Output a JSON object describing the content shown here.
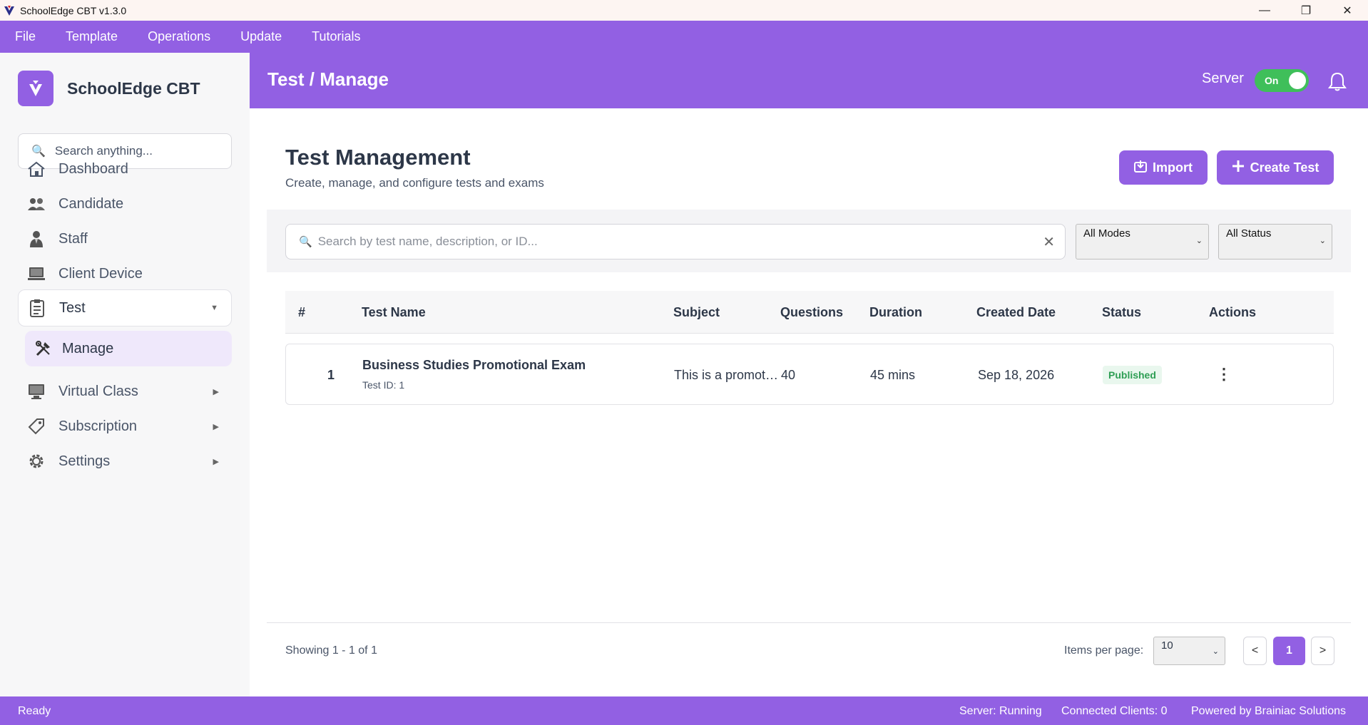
{
  "window": {
    "title": "SchoolEdge CBT v1.3.0",
    "controls": [
      "—",
      "❐",
      "✕"
    ]
  },
  "menubar": {
    "items": [
      "File",
      "Template",
      "Operations",
      "Update",
      "Tutorials"
    ]
  },
  "sidebar": {
    "brand": "SchoolEdge CBT",
    "search_placeholder": "Search anything...",
    "items": [
      {
        "label": "Dashboard",
        "icon": "house-icon"
      },
      {
        "label": "Candidate",
        "icon": "users-icon"
      },
      {
        "label": "Staff",
        "icon": "staff-icon"
      },
      {
        "label": "Client Device",
        "icon": "laptop-icon"
      },
      {
        "label": "Test",
        "icon": "clipboard-icon",
        "caret": "▼"
      },
      {
        "label": "Manage",
        "icon": "tools-icon"
      },
      {
        "label": "Virtual Class",
        "icon": "monitor-icon",
        "caret": "▶"
      },
      {
        "label": "Subscription",
        "icon": "tag-icon",
        "caret": "▶"
      },
      {
        "label": "Settings",
        "icon": "gear-icon",
        "caret": "▶"
      }
    ]
  },
  "header": {
    "breadcrumb": "Test / Manage",
    "server_label": "Server",
    "server_toggle": "On"
  },
  "main": {
    "title": "Test Management",
    "subtitle": "Create, manage, and configure tests and exams",
    "import_label": "Import",
    "create_label": "Create Test",
    "search_placeholder": "Search by test name, description, or ID...",
    "modes_select": "All Modes",
    "status_select": "All Status"
  },
  "table": {
    "headers": [
      "#",
      "Test Name",
      "Subject",
      "Questions",
      "Duration",
      "Created Date",
      "Status",
      "Actions"
    ],
    "rows": [
      {
        "num": "1",
        "name": "Business Studies Promotional Exam",
        "test_id": "Test ID: 1",
        "subject": "This is a promotional exam",
        "questions": "40",
        "duration": "45 mins",
        "created": "Sep 18, 2026",
        "status": "Published"
      }
    ]
  },
  "footer": {
    "showing": "Showing 1  -  1  of  1",
    "items_per_page_label": "Items per page:",
    "items_per_page": "10",
    "prev": "<",
    "current_page": "1",
    "next": ">"
  },
  "statusbar": {
    "left": "Ready",
    "server": "Server: Running",
    "clients": "Connected Clients: 0",
    "powered": "Powered by Brainiac Solutions"
  },
  "colors": {
    "accent": "#9260e3",
    "toggle_on": "#3fbf5a",
    "published": "#2e9e54"
  }
}
